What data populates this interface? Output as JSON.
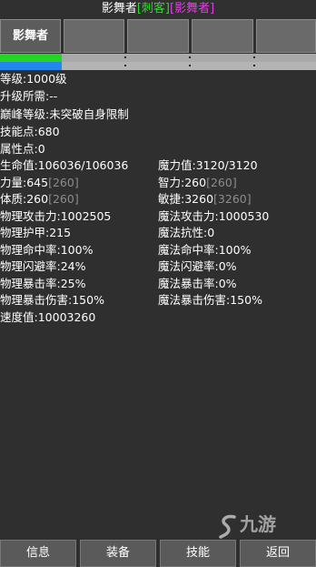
{
  "header": {
    "name": "影舞者",
    "class_tag": "[刺客]",
    "title_tag": "[影舞者]",
    "colors": {
      "class_tag": "#2ed82e",
      "title_tag": "#e040e0"
    }
  },
  "tabs": [
    {
      "label": "影舞者",
      "active": true
    },
    {
      "label": ""
    },
    {
      "label": ""
    },
    {
      "label": ""
    },
    {
      "label": ""
    }
  ],
  "bars": {
    "health_fill": 0.195,
    "mana_fill": 0.195,
    "colors": {
      "health": "#25d526",
      "mana": "#2288ee"
    }
  },
  "stats": {
    "level": "等级:1000级",
    "upgrade_required": "升级所需:--",
    "peak_level": "巅峰等级:未突破自身限制",
    "skill_points": "技能点:680",
    "attribute_points": "属性点:0",
    "hp": "生命值:106036/106036",
    "mp": "魔力值:3120/3120",
    "strength": "力量:645",
    "strength_bonus": "[260]",
    "intelligence": "智力:260",
    "intelligence_bonus": "[260]",
    "constitution": "体质:260",
    "constitution_bonus": "[260]",
    "agility": "敏捷:3260",
    "agility_bonus": "[3260]",
    "phys_attack": "物理攻击力:1002505",
    "magic_attack": "魔法攻击力:1000530",
    "phys_armor": "物理护甲:215",
    "magic_resist": "魔法抗性:0",
    "phys_hit": "物理命中率:100%",
    "magic_hit": "魔法命中率:100%",
    "phys_dodge": "物理闪避率:24%",
    "magic_dodge": "魔法闪避率:0%",
    "phys_crit": "物理暴击率:25%",
    "magic_crit": "魔法暴击率:0%",
    "phys_crit_dmg": "物理暴击伤害:150%",
    "magic_crit_dmg": "魔法暴击伤害:150%",
    "speed": "速度值:10003260"
  },
  "watermark": {
    "text": "九游",
    "icon": "jiuyou-logo-icon"
  },
  "bottom_nav": [
    {
      "label": "信息"
    },
    {
      "label": "装备"
    },
    {
      "label": "技能"
    },
    {
      "label": "返回"
    }
  ]
}
